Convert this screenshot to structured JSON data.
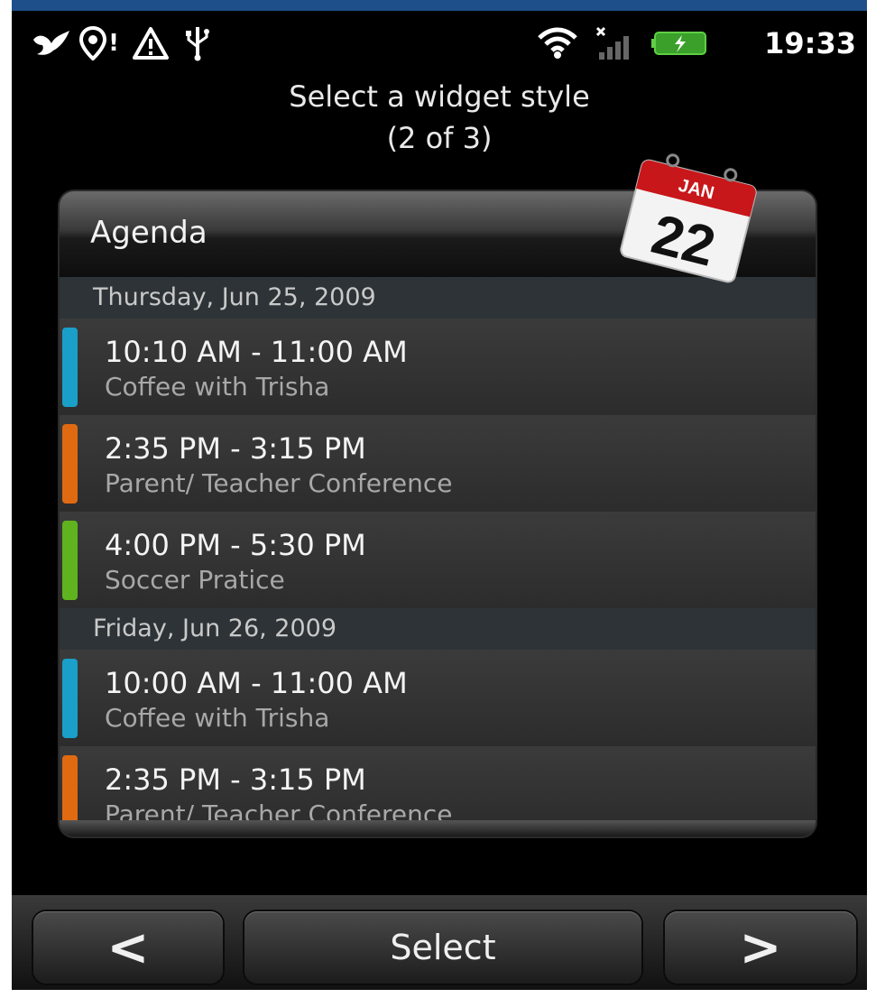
{
  "status_bar": {
    "time": "19:33",
    "icons": [
      "bird-icon",
      "location-alert-icon",
      "warning-icon",
      "usb-icon",
      "wifi-icon",
      "signal-icon",
      "battery-icon"
    ],
    "alert_glyph": "!"
  },
  "header": {
    "title": "Select a widget style",
    "subtitle": "(2 of 3)"
  },
  "widget": {
    "title": "Agenda",
    "calendar_icon": {
      "month": "JAN",
      "day": "22"
    },
    "days": [
      {
        "label": "Thursday, Jun 25, 2009",
        "events": [
          {
            "time": "10:10 AM - 11:00 AM",
            "title": "Coffee with Trisha",
            "color": "#1a9fc9"
          },
          {
            "time": "2:35 PM - 3:15 PM",
            "title": "Parent/ Teacher Conference",
            "color": "#e06a12"
          },
          {
            "time": "4:00 PM - 5:30 PM",
            "title": "Soccer Pratice",
            "color": "#5fb31e"
          }
        ]
      },
      {
        "label": "Friday, Jun 26, 2009",
        "events": [
          {
            "time": "10:00 AM - 11:00 AM",
            "title": "Coffee with Trisha",
            "color": "#1a9fc9"
          },
          {
            "time": "2:35 PM - 3:15 PM",
            "title": "Parent/ Teacher Conference",
            "color": "#e06a12"
          }
        ]
      }
    ]
  },
  "bottom_bar": {
    "prev_label": "<",
    "select_label": "Select",
    "next_label": ">"
  }
}
